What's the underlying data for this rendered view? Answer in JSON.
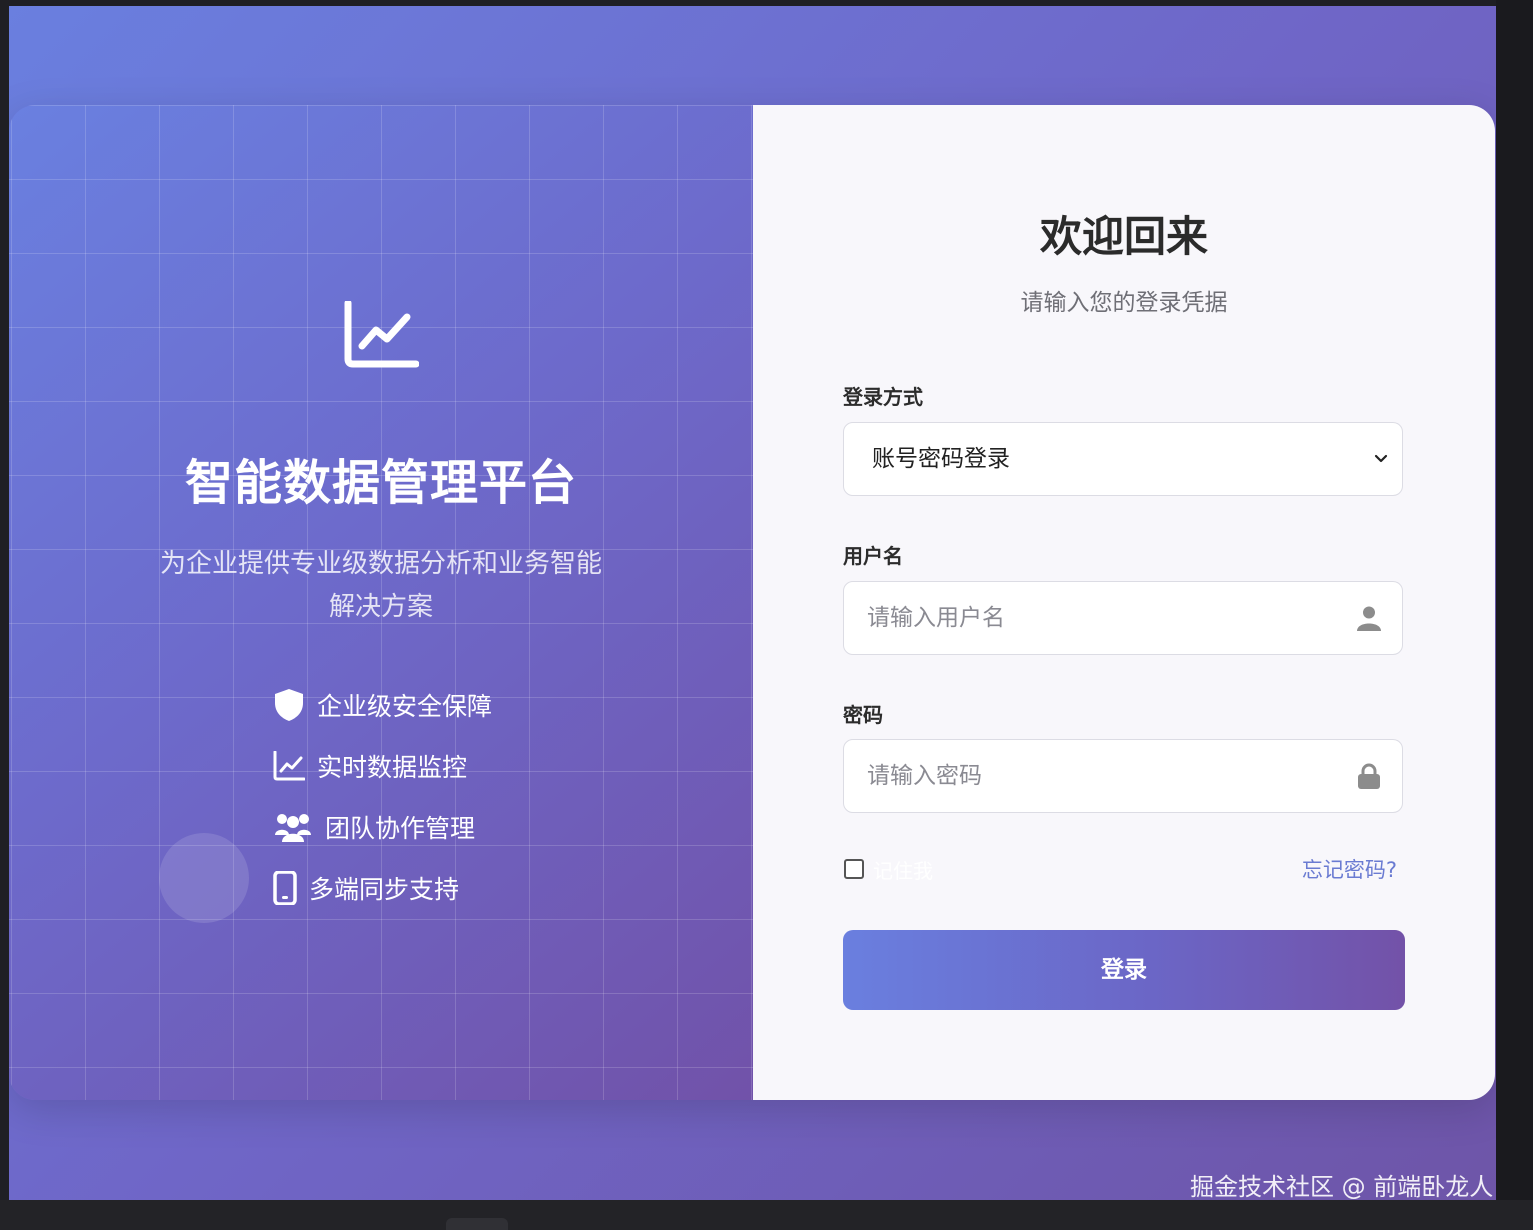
{
  "brand": {
    "title": "智能数据管理平台",
    "subtitle": "为企业提供专业级数据分析和业务智能解决方案",
    "icon": "chart-line-icon"
  },
  "features": [
    {
      "icon": "shield-icon",
      "label": "企业级安全保障"
    },
    {
      "icon": "chart-line-icon",
      "label": "实时数据监控"
    },
    {
      "icon": "users-icon",
      "label": "团队协作管理"
    },
    {
      "icon": "mobile-icon",
      "label": "多端同步支持"
    }
  ],
  "login": {
    "title": "欢迎回来",
    "subtitle": "请输入您的登录凭据",
    "method_label": "登录方式",
    "method_value": "账号密码登录",
    "username_label": "用户名",
    "username_placeholder": "请输入用户名",
    "password_label": "密码",
    "password_placeholder": "请输入密码",
    "remember_label": "记住我",
    "forgot_label": "忘记密码?",
    "submit_label": "登录"
  },
  "watermark": "掘金技术社区 @ 前端卧龙人",
  "colors": {
    "gradient_start": "#6a7fdf",
    "gradient_end": "#7352a8",
    "link": "#6a7bd2"
  }
}
